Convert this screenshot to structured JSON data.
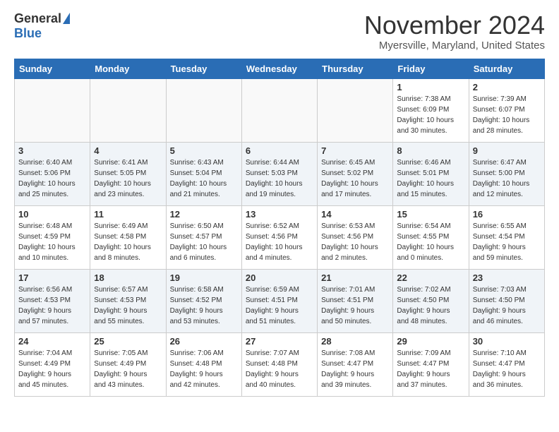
{
  "header": {
    "logo_general": "General",
    "logo_blue": "Blue",
    "month_title": "November 2024",
    "location": "Myersville, Maryland, United States"
  },
  "weekdays": [
    "Sunday",
    "Monday",
    "Tuesday",
    "Wednesday",
    "Thursday",
    "Friday",
    "Saturday"
  ],
  "weeks": [
    [
      {
        "day": "",
        "detail": ""
      },
      {
        "day": "",
        "detail": ""
      },
      {
        "day": "",
        "detail": ""
      },
      {
        "day": "",
        "detail": ""
      },
      {
        "day": "",
        "detail": ""
      },
      {
        "day": "1",
        "detail": "Sunrise: 7:38 AM\nSunset: 6:09 PM\nDaylight: 10 hours\nand 30 minutes."
      },
      {
        "day": "2",
        "detail": "Sunrise: 7:39 AM\nSunset: 6:07 PM\nDaylight: 10 hours\nand 28 minutes."
      }
    ],
    [
      {
        "day": "3",
        "detail": "Sunrise: 6:40 AM\nSunset: 5:06 PM\nDaylight: 10 hours\nand 25 minutes."
      },
      {
        "day": "4",
        "detail": "Sunrise: 6:41 AM\nSunset: 5:05 PM\nDaylight: 10 hours\nand 23 minutes."
      },
      {
        "day": "5",
        "detail": "Sunrise: 6:43 AM\nSunset: 5:04 PM\nDaylight: 10 hours\nand 21 minutes."
      },
      {
        "day": "6",
        "detail": "Sunrise: 6:44 AM\nSunset: 5:03 PM\nDaylight: 10 hours\nand 19 minutes."
      },
      {
        "day": "7",
        "detail": "Sunrise: 6:45 AM\nSunset: 5:02 PM\nDaylight: 10 hours\nand 17 minutes."
      },
      {
        "day": "8",
        "detail": "Sunrise: 6:46 AM\nSunset: 5:01 PM\nDaylight: 10 hours\nand 15 minutes."
      },
      {
        "day": "9",
        "detail": "Sunrise: 6:47 AM\nSunset: 5:00 PM\nDaylight: 10 hours\nand 12 minutes."
      }
    ],
    [
      {
        "day": "10",
        "detail": "Sunrise: 6:48 AM\nSunset: 4:59 PM\nDaylight: 10 hours\nand 10 minutes."
      },
      {
        "day": "11",
        "detail": "Sunrise: 6:49 AM\nSunset: 4:58 PM\nDaylight: 10 hours\nand 8 minutes."
      },
      {
        "day": "12",
        "detail": "Sunrise: 6:50 AM\nSunset: 4:57 PM\nDaylight: 10 hours\nand 6 minutes."
      },
      {
        "day": "13",
        "detail": "Sunrise: 6:52 AM\nSunset: 4:56 PM\nDaylight: 10 hours\nand 4 minutes."
      },
      {
        "day": "14",
        "detail": "Sunrise: 6:53 AM\nSunset: 4:56 PM\nDaylight: 10 hours\nand 2 minutes."
      },
      {
        "day": "15",
        "detail": "Sunrise: 6:54 AM\nSunset: 4:55 PM\nDaylight: 10 hours\nand 0 minutes."
      },
      {
        "day": "16",
        "detail": "Sunrise: 6:55 AM\nSunset: 4:54 PM\nDaylight: 9 hours\nand 59 minutes."
      }
    ],
    [
      {
        "day": "17",
        "detail": "Sunrise: 6:56 AM\nSunset: 4:53 PM\nDaylight: 9 hours\nand 57 minutes."
      },
      {
        "day": "18",
        "detail": "Sunrise: 6:57 AM\nSunset: 4:53 PM\nDaylight: 9 hours\nand 55 minutes."
      },
      {
        "day": "19",
        "detail": "Sunrise: 6:58 AM\nSunset: 4:52 PM\nDaylight: 9 hours\nand 53 minutes."
      },
      {
        "day": "20",
        "detail": "Sunrise: 6:59 AM\nSunset: 4:51 PM\nDaylight: 9 hours\nand 51 minutes."
      },
      {
        "day": "21",
        "detail": "Sunrise: 7:01 AM\nSunset: 4:51 PM\nDaylight: 9 hours\nand 50 minutes."
      },
      {
        "day": "22",
        "detail": "Sunrise: 7:02 AM\nSunset: 4:50 PM\nDaylight: 9 hours\nand 48 minutes."
      },
      {
        "day": "23",
        "detail": "Sunrise: 7:03 AM\nSunset: 4:50 PM\nDaylight: 9 hours\nand 46 minutes."
      }
    ],
    [
      {
        "day": "24",
        "detail": "Sunrise: 7:04 AM\nSunset: 4:49 PM\nDaylight: 9 hours\nand 45 minutes."
      },
      {
        "day": "25",
        "detail": "Sunrise: 7:05 AM\nSunset: 4:49 PM\nDaylight: 9 hours\nand 43 minutes."
      },
      {
        "day": "26",
        "detail": "Sunrise: 7:06 AM\nSunset: 4:48 PM\nDaylight: 9 hours\nand 42 minutes."
      },
      {
        "day": "27",
        "detail": "Sunrise: 7:07 AM\nSunset: 4:48 PM\nDaylight: 9 hours\nand 40 minutes."
      },
      {
        "day": "28",
        "detail": "Sunrise: 7:08 AM\nSunset: 4:47 PM\nDaylight: 9 hours\nand 39 minutes."
      },
      {
        "day": "29",
        "detail": "Sunrise: 7:09 AM\nSunset: 4:47 PM\nDaylight: 9 hours\nand 37 minutes."
      },
      {
        "day": "30",
        "detail": "Sunrise: 7:10 AM\nSunset: 4:47 PM\nDaylight: 9 hours\nand 36 minutes."
      }
    ]
  ]
}
